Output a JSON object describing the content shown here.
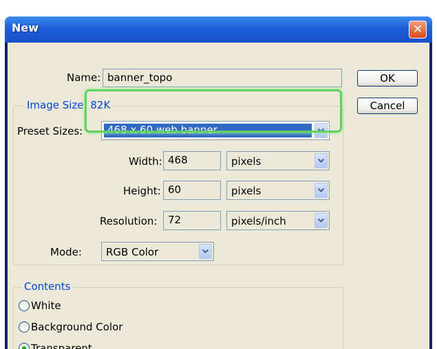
{
  "dialog": {
    "title": "New",
    "close_glyph": "✕"
  },
  "form": {
    "name_label": "Name:",
    "name_value": "banner_topo",
    "image_size_label": "Image Size: 82K",
    "preset_label": "Preset Sizes:",
    "preset_value": "468 x 60 web banner",
    "width_label": "Width:",
    "width_value": "468",
    "width_unit": "pixels",
    "height_label": "Height:",
    "height_value": "60",
    "height_unit": "pixels",
    "resolution_label": "Resolution:",
    "resolution_value": "72",
    "resolution_unit": "pixels/inch",
    "mode_label": "Mode:",
    "mode_value": "RGB Color"
  },
  "buttons": {
    "ok": "OK",
    "cancel": "Cancel"
  },
  "contents": {
    "legend": "Contents",
    "options": [
      "White",
      "Background Color",
      "Transparent"
    ],
    "selected": "Transparent"
  },
  "colors": {
    "title_bar": "#2060d8",
    "dialog_bg": "#ece9d8",
    "selection": "#316ac5",
    "highlight_box": "#5fd15f",
    "legend_text": "#0046d5"
  }
}
